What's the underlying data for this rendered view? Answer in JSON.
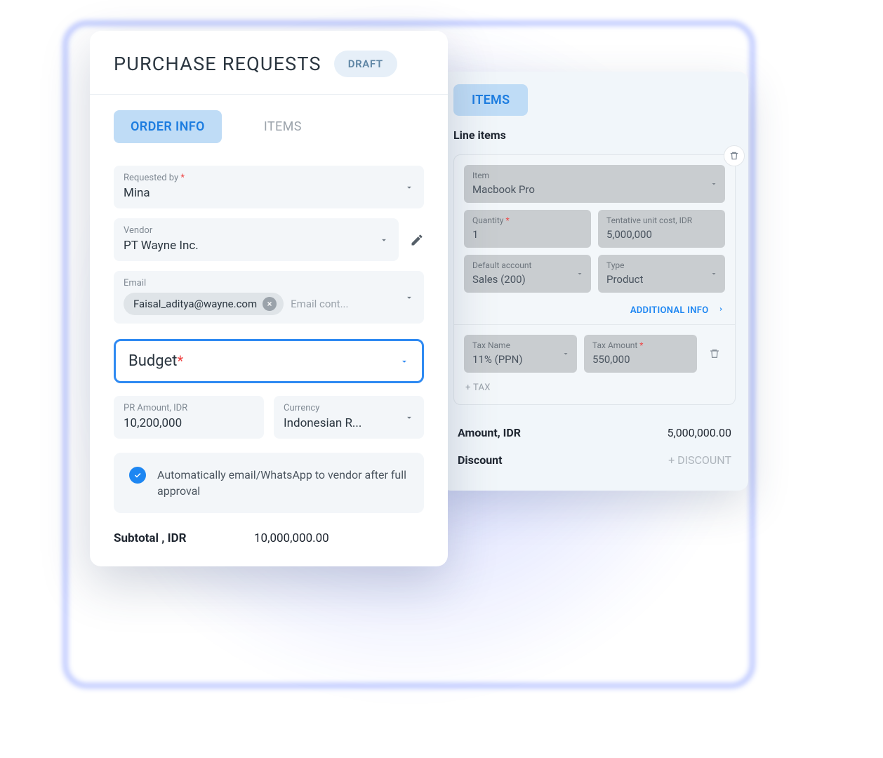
{
  "header": {
    "title": "PURCHASE REQUESTS",
    "status_badge": "DRAFT"
  },
  "tabs": {
    "order_info": "ORDER INFO",
    "items": "ITEMS"
  },
  "order_info": {
    "requested_by": {
      "label": "Requested by",
      "value": "Mina"
    },
    "vendor": {
      "label": "Vendor",
      "value": "PT Wayne Inc."
    },
    "email": {
      "label": "Email",
      "chip": "Faisal_aditya@wayne.com",
      "placeholder": "Email cont..."
    },
    "budget": {
      "label": "Budget"
    },
    "pr_amount": {
      "label": "PR Amount, IDR",
      "value": "10,200,000"
    },
    "currency": {
      "label": "Currency",
      "value": "Indonesian R..."
    },
    "notify_text": "Automatically email/WhatsApp to vendor after full approval",
    "subtotal": {
      "label": "Subtotal , IDR",
      "value": "10,000,000.00"
    }
  },
  "items_panel": {
    "tab": "ITEMS",
    "section": "Line items",
    "item": {
      "label": "Item",
      "value": "Macbook Pro"
    },
    "quantity": {
      "label": "Quantity",
      "value": "1"
    },
    "unit_cost": {
      "label": "Tentative unit cost, IDR",
      "value": "5,000,000"
    },
    "default_account": {
      "label": "Default account",
      "value": "Sales (200)"
    },
    "type": {
      "label": "Type",
      "value": "Product"
    },
    "additional_info": "ADDITIONAL INFO",
    "tax_name": {
      "label": "Tax Name",
      "value": "11% (PPN)"
    },
    "tax_amount": {
      "label": "Tax Amount",
      "value": "550,000"
    },
    "add_tax": "+ TAX",
    "amount": {
      "label": "Amount, IDR",
      "value": "5,000,000.00"
    },
    "discount": {
      "label": "Discount",
      "placeholder": "+ DISCOUNT"
    }
  }
}
